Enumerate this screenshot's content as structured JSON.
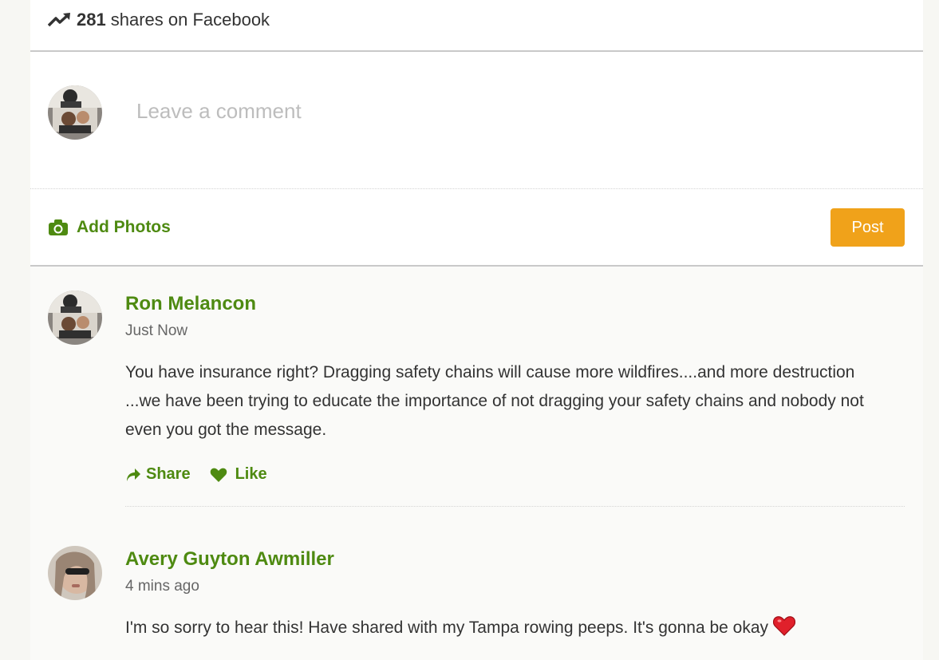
{
  "shares": {
    "count": "281",
    "label": "shares on Facebook",
    "icon": "trending-up-icon"
  },
  "composer": {
    "placeholder": "Leave a comment",
    "add_photos_label": "Add Photos",
    "post_label": "Post",
    "accent_color": "#4e8a11",
    "post_color": "#f0a21a"
  },
  "comments": [
    {
      "author": "Ron Melancon",
      "time": "Just Now",
      "text": "You have insurance right? Dragging safety chains will cause more wildfires....and more destruction ...we have been trying to educate the importance of not dragging your safety chains and nobody not even you got the message.",
      "share_label": "Share",
      "like_label": "Like"
    },
    {
      "author": "Avery Guyton Awmiller",
      "time": "4 mins ago",
      "text": "I'm so sorry to hear this! Have shared with my Tampa rowing peeps. It's gonna be okay"
    }
  ]
}
